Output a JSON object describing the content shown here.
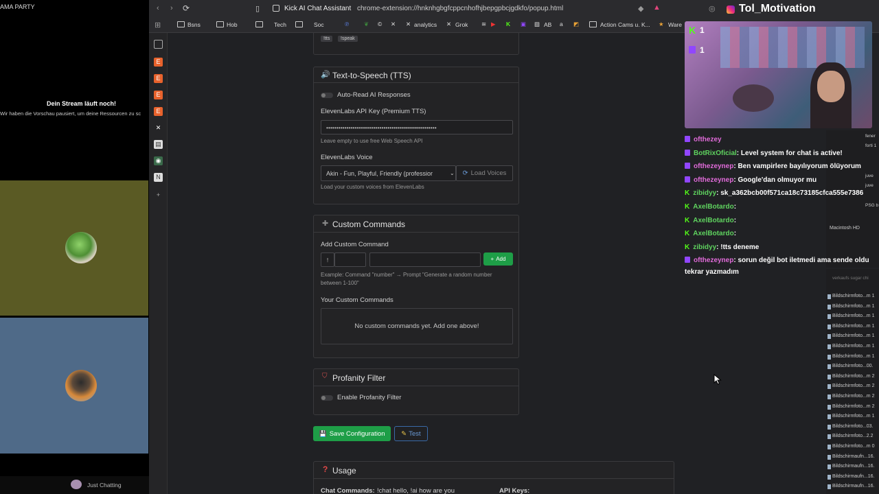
{
  "left_panel": {
    "top_label": "AMA PARTY",
    "notice_title": "Dein Stream läuft noch!",
    "notice_subtitle": "Wir haben die Vorschau pausiert, um deine Ressourcen zu sc",
    "bottom_label": "Just Chatting"
  },
  "browser": {
    "tab_title": "Kick AI Chat Assistant",
    "url": "chrome-extension://hnknhgbgfcppcnhofhjbepgpbcjgdkfo/popup.html",
    "bookmarks": [
      "Bsns",
      "Hob",
      "Tech",
      "Soc",
      "analytics",
      "Grok",
      "AB",
      "Action Cams u. K...",
      "Ware"
    ]
  },
  "tags": [
    "!tts",
    "!speak"
  ],
  "tts": {
    "title": "Text-to-Speech (TTS)",
    "auto_read_label": "Auto-Read AI Responses",
    "api_key_label": "ElevenLabs API Key (Premium TTS)",
    "api_key_value": "••••••••••••••••••••••••••••••••••••••••••••••••••••••",
    "api_key_hint": "Leave empty to use free Web Speech API",
    "voice_label": "ElevenLabs Voice",
    "voice_value": "Akin - Fun, Playful, Friendly (professior",
    "load_voices_label": "Load Voices",
    "voice_hint": "Load your custom voices from ElevenLabs"
  },
  "commands": {
    "title": "Custom Commands",
    "add_label": "Add Custom Command",
    "prefix": "!",
    "add_button": "Add",
    "example": "Example: Command \"number\" → Prompt \"Generate a random number between 1-100\"",
    "your_label": "Your Custom Commands",
    "empty_text": "No custom commands yet. Add one above!"
  },
  "profanity": {
    "title": "Profanity Filter",
    "enable_label": "Enable Profanity Filter"
  },
  "actions": {
    "save_label": "Save Configuration",
    "test_label": "Test"
  },
  "usage": {
    "title": "Usage",
    "chat_commands_label": "Chat Commands:",
    "chat_commands_value": "!chat hello, !ai how are you",
    "api_keys_label": "API Keys:"
  },
  "overlay": {
    "channel": "Tol_Motivation",
    "chat": [
      {
        "platform": "twitch",
        "user": "ofthezey",
        "text": ""
      },
      {
        "platform": "twitch",
        "user": "BotRixOficial",
        "text": ": Level system for chat is active!"
      },
      {
        "platform": "twitch",
        "user": "ofthezeynep",
        "text": ": Ben vampirlere bayılıyorum ölüyorum"
      },
      {
        "platform": "twitch",
        "user": "ofthezeynep",
        "text": ": Google'dan olmuyor mu"
      },
      {
        "platform": "kick",
        "user": "zibidyy",
        "text": ": sk_a362bcb00f571ca18c73185cfca555e7386"
      },
      {
        "platform": "kick",
        "user": "AxelBotardo",
        "text": ":"
      },
      {
        "platform": "kick",
        "user": "AxelBotardo",
        "text": ":"
      },
      {
        "platform": "kick",
        "user": "AxelBotardo",
        "text": ":"
      },
      {
        "platform": "kick",
        "user": "zibidyy",
        "text": ": !tts deneme"
      },
      {
        "platform": "twitch",
        "user": "ofthezeynep",
        "text": ": sorun değil bot iletmedi ama sende oldu"
      }
    ],
    "chat_continuation": "tekrar yazmadım"
  },
  "finder": {
    "path": "Macintosh HD",
    "header": "verkaufs sugar chi",
    "files": [
      "Bildschirmfoto...m 1",
      "Bildschirmfoto...m 1",
      "Bildschirmfoto...m 1",
      "Bildschirmfoto...m 1",
      "Bildschirmfoto...m 1",
      "Bildschirmfoto...m 1",
      "Bildschirmfoto...m 1",
      "Bildschirmfoto...00.",
      "Bildschirmfoto...m 2",
      "Bildschirmfoto...m 2",
      "Bildschirmfoto...m 2",
      "Bildschirmfoto...m 2",
      "Bildschirmfoto...m 1",
      "Bildschirmfoto...03.",
      "Bildschirmfoto...2.2",
      "Bildschirmfoto...m 0",
      "Bildschirmaufn...16.",
      "Bildschirmaufn...16.",
      "Bildschirmaufn...16.",
      "Bildschirmaufn...16."
    ],
    "right_items": [
      "fener",
      "forti 1",
      "juve",
      "juve",
      "PSG b"
    ]
  }
}
